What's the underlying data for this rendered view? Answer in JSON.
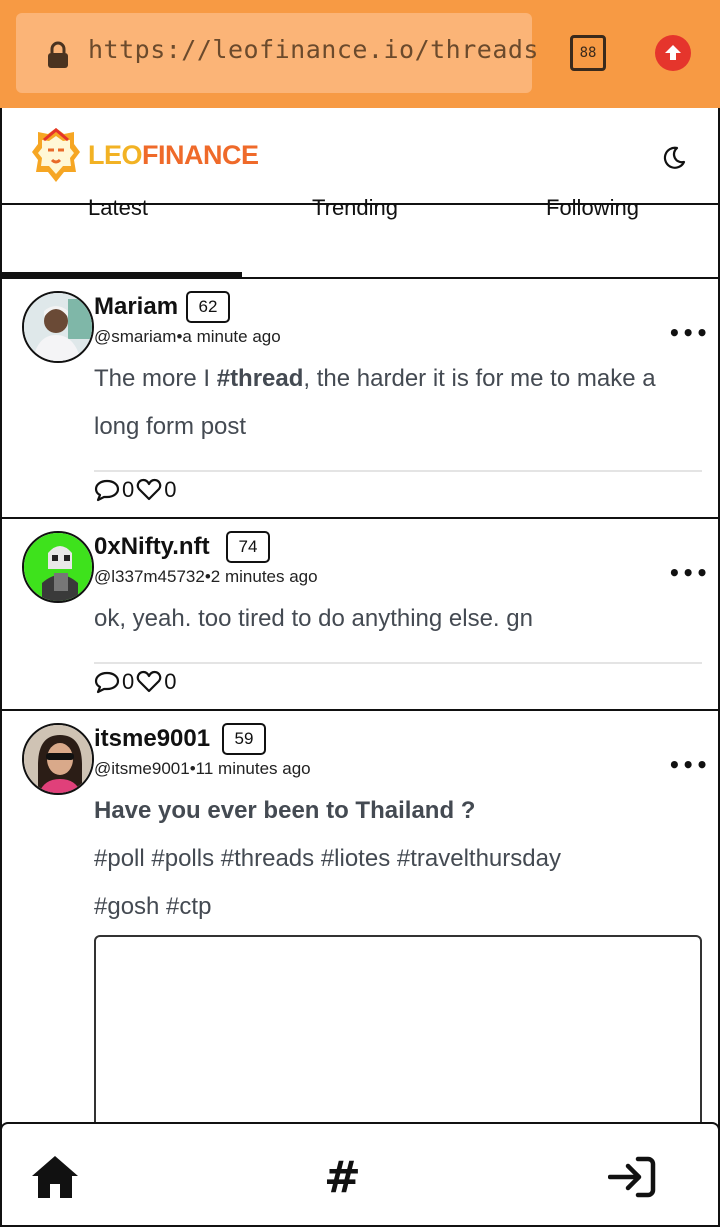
{
  "browser": {
    "url": "https://leofinance.io/threads",
    "tab_count": "88"
  },
  "header": {
    "logo_leo": "LEO",
    "logo_finance": "FINANCE"
  },
  "tabs": [
    {
      "label": "Latest",
      "active": true
    },
    {
      "label": "Trending",
      "active": false
    },
    {
      "label": "Following",
      "active": false
    }
  ],
  "posts": [
    {
      "author": "Mariam",
      "reputation": "62",
      "handle": "@smariam",
      "time": "a minute ago",
      "body_pre": "The more I ",
      "body_tag": "#thread",
      "body_post": ", the harder it is for me to make a long form post",
      "comments": "0",
      "likes": "0"
    },
    {
      "author": "0xNifty.nft",
      "reputation": "74",
      "handle": "@l337m45732",
      "time": "2 minutes ago",
      "body": "ok, yeah. too tired to do anything else. gn",
      "comments": "0",
      "likes": "0"
    },
    {
      "author": "itsme9001",
      "reputation": "59",
      "handle": "@itsme9001",
      "time": "11 minutes ago",
      "title": "Have you ever been to Thailand ?",
      "tags_line1": "#poll #polls #threads #liotes #travelthursday",
      "tags_line2": "#gosh #ctp"
    }
  ],
  "separator": "•",
  "colors": {
    "browser_bar": "#f79a44",
    "url_box": "#fbb477",
    "logo_leo": "#f2b224",
    "logo_finance": "#ef6a2a",
    "upload_button": "#e5352c"
  }
}
